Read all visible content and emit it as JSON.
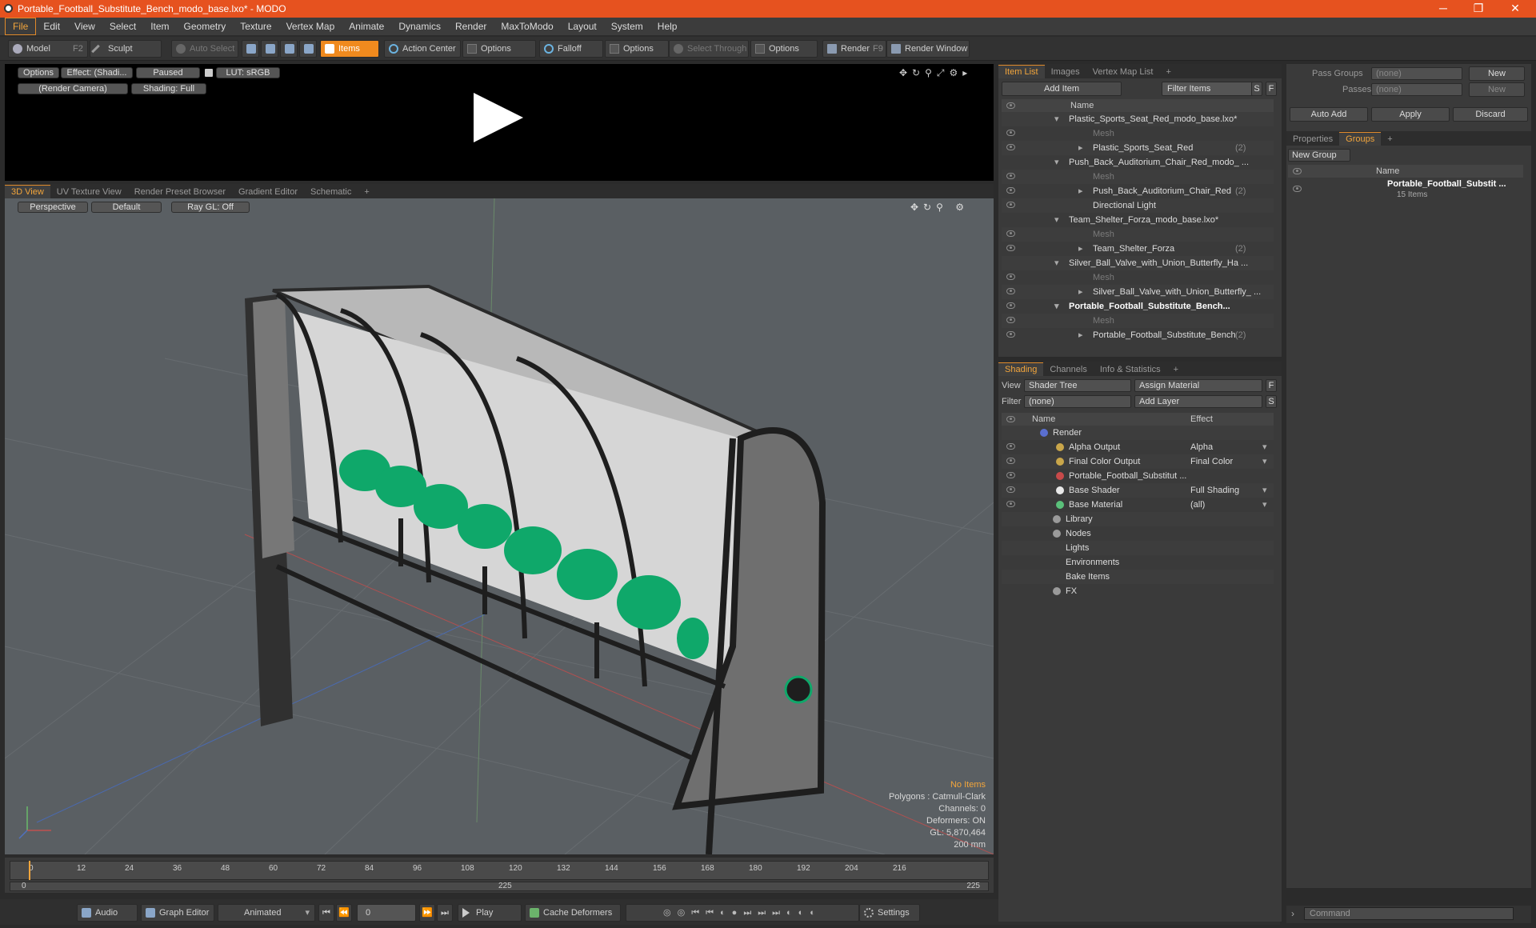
{
  "title_bar": {
    "title": "Portable_Football_Substitute_Bench_modo_base.lxo* - MODO",
    "minimize": "─",
    "maximize": "❐",
    "close": "✕"
  },
  "menu": [
    "File",
    "Edit",
    "View",
    "Select",
    "Item",
    "Geometry",
    "Texture",
    "Vertex Map",
    "Animate",
    "Dynamics",
    "Render",
    "MaxToModo",
    "Layout",
    "System",
    "Help"
  ],
  "toolbar": {
    "model": "Model",
    "model_key": "F2",
    "sculpt": "Sculpt",
    "auto_select": "Auto Select",
    "items": "Items",
    "action_center": "Action Center",
    "options1": "Options",
    "falloff": "Falloff",
    "options2": "Options",
    "select_through": "Select Through",
    "options3": "Options",
    "render": "Render",
    "render_key": "F9",
    "render_window": "Render Window"
  },
  "render_preview": {
    "options": "Options",
    "effect": "Effect: (Shadi...",
    "paused": "Paused",
    "lut": "LUT: sRGB",
    "camera": "(Render Camera)",
    "shading": "Shading: Full"
  },
  "viewport_tabs": [
    "3D View",
    "UV Texture View",
    "Render Preset Browser",
    "Gradient Editor",
    "Schematic",
    "+"
  ],
  "viewport": {
    "perspective": "Perspective",
    "default": "Default",
    "raygl": "Ray GL: Off",
    "stats": {
      "items": "No Items",
      "polygons": "Polygons : Catmull-Clark",
      "channels": "Channels: 0",
      "deformers": "Deformers: ON",
      "gl": "GL: 5,870,464",
      "scale": "200 mm"
    }
  },
  "timeline": {
    "ticks": [
      "0",
      "12",
      "24",
      "36",
      "48",
      "60",
      "72",
      "84",
      "96",
      "108",
      "120",
      "132",
      "144",
      "156",
      "168",
      "180",
      "192",
      "204",
      "216"
    ],
    "range_start": "0",
    "range_mid": "225",
    "range_end": "225"
  },
  "bottom_bar": {
    "audio": "Audio",
    "graph_editor": "Graph Editor",
    "animated": "Animated",
    "frame": "0",
    "play": "Play",
    "cache": "Cache Deformers",
    "settings": "Settings"
  },
  "item_list": {
    "tabs": [
      "Item List",
      "Images",
      "Vertex Map List",
      "+"
    ],
    "add_item": "Add Item",
    "filter_items": "Filter Items",
    "s": "S",
    "f": "F",
    "col_name": "Name",
    "rows": [
      {
        "label": "Plastic_Sports_Seat_Red_modo_base.lxo*",
        "indent": 1,
        "style": "scene",
        "eye": false
      },
      {
        "label": "Mesh",
        "indent": 2,
        "style": "dim",
        "eye": true
      },
      {
        "label": "Plastic_Sports_Seat_Red",
        "count": "(2)",
        "indent": 2,
        "style": "group",
        "eye": true
      },
      {
        "label": "Push_Back_Auditorium_Chair_Red_modo_ ...",
        "indent": 1,
        "style": "scene",
        "eye": false
      },
      {
        "label": "Mesh",
        "indent": 2,
        "style": "dim",
        "eye": true
      },
      {
        "label": "Push_Back_Auditorium_Chair_Red",
        "count": "(2)",
        "indent": 2,
        "style": "group",
        "eye": true
      },
      {
        "label": "Directional Light",
        "indent": 2,
        "style": "light",
        "eye": true
      },
      {
        "label": "Team_Shelter_Forza_modo_base.lxo*",
        "indent": 1,
        "style": "scene",
        "eye": false
      },
      {
        "label": "Mesh",
        "indent": 2,
        "style": "dim",
        "eye": true
      },
      {
        "label": "Team_Shelter_Forza",
        "count": "(2)",
        "indent": 2,
        "style": "group",
        "eye": true
      },
      {
        "label": "Silver_Ball_Valve_with_Union_Butterfly_Ha ...",
        "indent": 1,
        "style": "scene",
        "eye": false
      },
      {
        "label": "Mesh",
        "indent": 2,
        "style": "dim",
        "eye": true
      },
      {
        "label": "Silver_Ball_Valve_with_Union_Butterfly_ ...",
        "indent": 2,
        "style": "group",
        "eye": true
      },
      {
        "label": "Portable_Football_Substitute_Bench...",
        "indent": 1,
        "style": "bold",
        "eye": true
      },
      {
        "label": "Mesh",
        "indent": 2,
        "style": "dim",
        "eye": true
      },
      {
        "label": "Portable_Football_Substitute_Bench",
        "count": "(2)",
        "indent": 2,
        "style": "group",
        "eye": true
      }
    ]
  },
  "shading": {
    "tabs": [
      "Shading",
      "Channels",
      "Info & Statistics",
      "+"
    ],
    "view_label": "View",
    "view_value": "Shader Tree",
    "assign": "Assign Material",
    "f": "F",
    "filter_label": "Filter",
    "filter_value": "(none)",
    "add_layer": "Add Layer",
    "s": "S",
    "col_name": "Name",
    "col_effect": "Effect",
    "rows": [
      {
        "label": "Render",
        "effect": "",
        "indent": 1,
        "eye": false,
        "icon": "render-sphere-icon"
      },
      {
        "label": "Alpha Output",
        "effect": "Alpha",
        "indent": 2,
        "eye": true,
        "icon": "output-icon"
      },
      {
        "label": "Final Color Output",
        "effect": "Final Color",
        "indent": 2,
        "eye": true,
        "icon": "output-icon"
      },
      {
        "label": "Portable_Football_Substitut ...",
        "effect": "",
        "indent": 2,
        "eye": true,
        "icon": "material-group-icon"
      },
      {
        "label": "Base Shader",
        "effect": "Full Shading",
        "indent": 2,
        "eye": true,
        "icon": "shader-icon"
      },
      {
        "label": "Base Material",
        "effect": "(all)",
        "indent": 2,
        "eye": true,
        "icon": "material-icon"
      },
      {
        "label": "Library",
        "effect": "",
        "indent": 3,
        "eye": false,
        "icon": "folder-icon"
      },
      {
        "label": "Nodes",
        "effect": "",
        "indent": 3,
        "eye": false,
        "icon": "folder-icon"
      },
      {
        "label": "Lights",
        "effect": "",
        "indent": 3,
        "eye": false,
        "icon": ""
      },
      {
        "label": "Environments",
        "effect": "",
        "indent": 3,
        "eye": false,
        "icon": ""
      },
      {
        "label": "Bake Items",
        "effect": "",
        "indent": 3,
        "eye": false,
        "icon": ""
      },
      {
        "label": "FX",
        "effect": "",
        "indent": 3,
        "eye": false,
        "icon": "fx-icon"
      }
    ]
  },
  "groups_panel": {
    "pass_groups": "Pass Groups",
    "pass_groups_val": "(none)",
    "new1": "New",
    "passes": "Passes",
    "passes_val": "(none)",
    "new2": "New",
    "auto_add": "Auto Add",
    "apply": "Apply",
    "discard": "Discard",
    "tabs": [
      "Properties",
      "Groups",
      "+"
    ],
    "new_group": "New Group",
    "col_name": "Name",
    "group_name": "Portable_Football_Substit ...",
    "group_count": "15 Items"
  },
  "command": {
    "placeholder": "Command"
  }
}
